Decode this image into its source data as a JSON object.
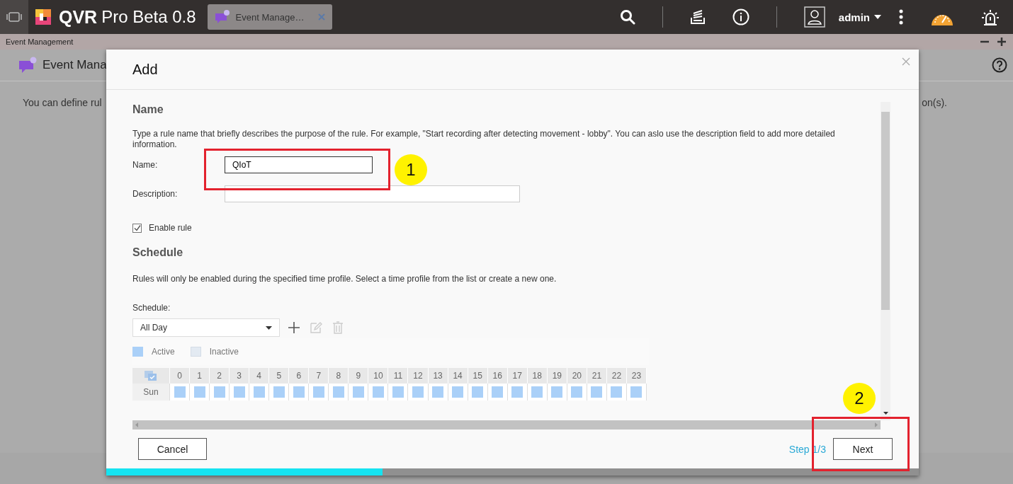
{
  "app_bar": {
    "brand": "QVR",
    "product": "Pro Beta 0.8",
    "tab": {
      "label": "Event Manage…",
      "selected": true
    },
    "user": "admin"
  },
  "window_strip": {
    "title": "Event Management"
  },
  "page": {
    "title": "Event Mana",
    "intro_start": "You can define rul",
    "intro_end": "on(s)."
  },
  "dialog": {
    "title": "Add",
    "name_section": {
      "heading": "Name",
      "help": "Type a rule name that briefly describes the purpose of the rule. For example, \"Start recording after detecting movement - lobby\". You can aslo use the description field to add more detailed information.",
      "name_label": "Name:",
      "name_value": "QIoT",
      "description_label": "Description:",
      "enable_rule": {
        "label": "Enable rule",
        "checked": true
      }
    },
    "schedule_section": {
      "heading": "Schedule",
      "help": "Rules will only be enabled during the specified time profile. Select a time profile from the list or create a new one.",
      "schedule_label": "Schedule:",
      "schedule_value": "All Day",
      "legend": [
        {
          "label": "Active",
          "kind": "active"
        },
        {
          "label": "Inactive",
          "kind": "inactive"
        }
      ],
      "hours": [
        "0",
        "1",
        "2",
        "3",
        "4",
        "5",
        "6",
        "7",
        "8",
        "9",
        "10",
        "11",
        "12",
        "13",
        "14",
        "15",
        "16",
        "17",
        "18",
        "19",
        "20",
        "21",
        "22",
        "23"
      ],
      "rows": [
        {
          "day": "Sun",
          "cells": [
            true,
            true,
            true,
            true,
            true,
            true,
            true,
            true,
            true,
            true,
            true,
            true,
            true,
            true,
            true,
            true,
            true,
            true,
            true,
            true,
            true,
            true,
            true,
            true
          ]
        }
      ]
    },
    "cancel": "Cancel",
    "step": "Step 1/3",
    "next": "Next",
    "progress": {
      "level": 0.34
    }
  },
  "annotations": [
    {
      "label": "1"
    },
    {
      "label": "2"
    }
  ]
}
